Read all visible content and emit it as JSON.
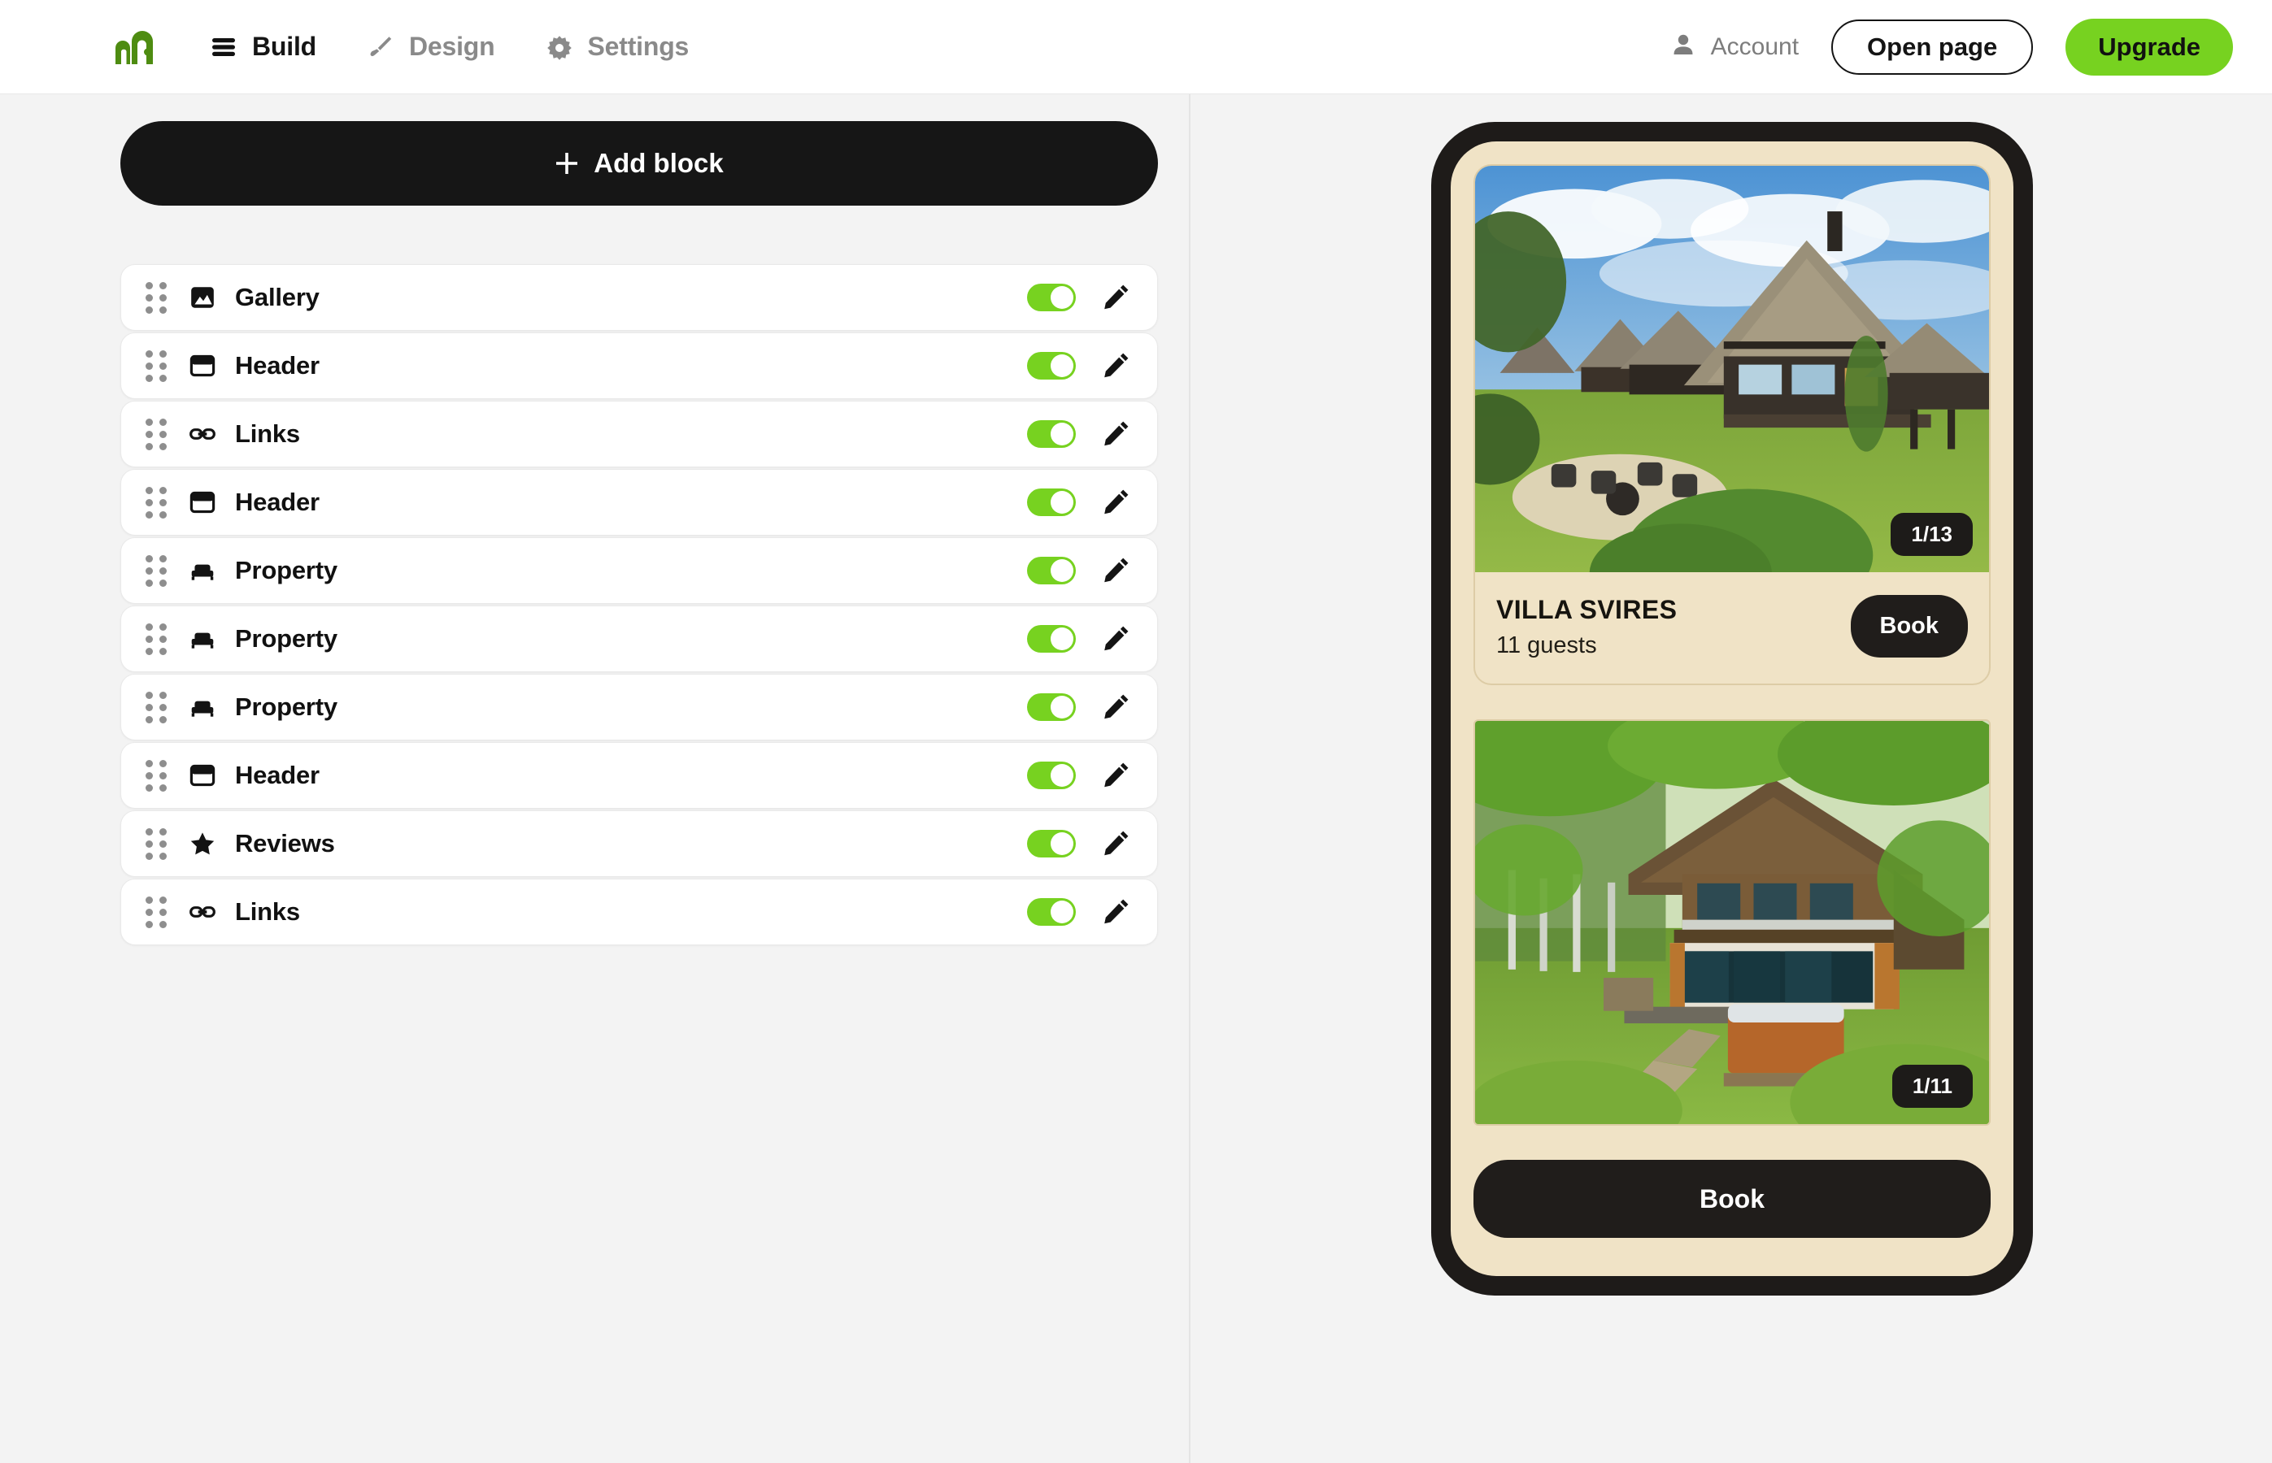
{
  "topbar": {
    "logo_icon": "arch-house-logo",
    "nav": [
      {
        "label": "Build",
        "icon": "hamburger-icon",
        "active": true
      },
      {
        "label": "Design",
        "icon": "paintbrush-icon",
        "active": false
      },
      {
        "label": "Settings",
        "icon": "gear-icon",
        "active": false
      }
    ],
    "account_label": "Account",
    "account_icon": "user-icon",
    "open_page_label": "Open page",
    "upgrade_label": "Upgrade"
  },
  "builder": {
    "add_block_label": "Add block",
    "add_block_icon": "plus-icon",
    "blocks": [
      {
        "label": "Gallery",
        "icon": "image-icon",
        "enabled": true,
        "toggle_state": "on"
      },
      {
        "label": "Header",
        "icon": "header-icon",
        "enabled": true,
        "toggle_state": "on"
      },
      {
        "label": "Links",
        "icon": "link-icon",
        "enabled": true,
        "toggle_state": "on"
      },
      {
        "label": "Header",
        "icon": "header-icon",
        "enabled": true,
        "toggle_state": "on"
      },
      {
        "label": "Property",
        "icon": "bed-icon",
        "enabled": true,
        "toggle_state": "on"
      },
      {
        "label": "Property",
        "icon": "bed-icon",
        "enabled": true,
        "toggle_state": "on"
      },
      {
        "label": "Property",
        "icon": "bed-icon",
        "enabled": true,
        "toggle_state": "on"
      },
      {
        "label": "Header",
        "icon": "header-icon",
        "enabled": true,
        "toggle_state": "on"
      },
      {
        "label": "Reviews",
        "icon": "star-icon",
        "enabled": true,
        "toggle_state": "on"
      },
      {
        "label": "Links",
        "icon": "link-icon",
        "enabled": true,
        "toggle_state": "on"
      }
    ]
  },
  "preview": {
    "cards": [
      {
        "photo_alt": "thatched-roof villa with lawn and fire pit",
        "counter": "1/13",
        "title": "VILLA SVIRES",
        "subtitle": "11 guests",
        "book_label": "Book"
      },
      {
        "photo_alt": "wooden chalet in forest with hot tub",
        "counter": "1/11",
        "book_label": "Book"
      }
    ]
  },
  "colors": {
    "accent_green": "#77d220",
    "dark": "#161616",
    "panel_bg": "#f3f3f3",
    "phone_frame": "#1e1b19",
    "phone_screen": "#f0e3c6"
  }
}
